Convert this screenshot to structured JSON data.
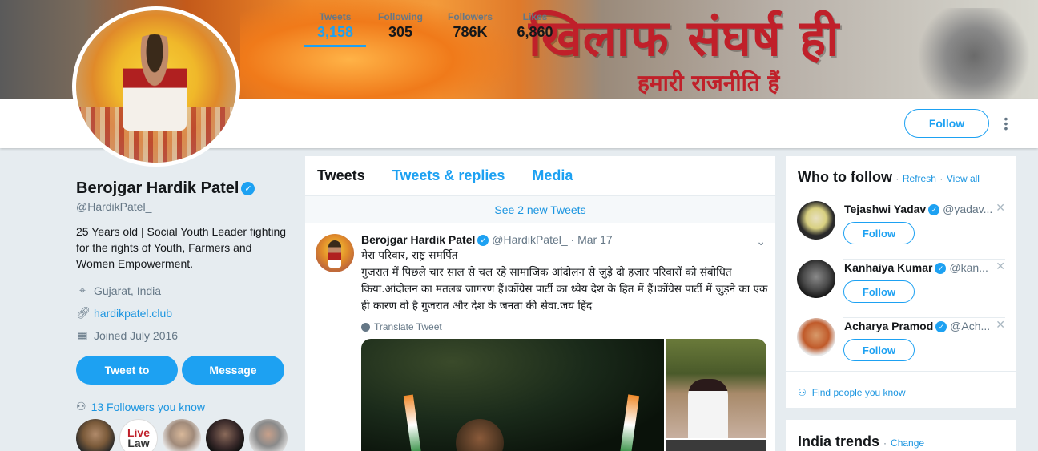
{
  "banner": {
    "headline": "खिलाफ संघर्ष ही",
    "subline": "हमारी राजनीति हैं"
  },
  "nav": {
    "stats": [
      {
        "label": "Tweets",
        "value": "3,158"
      },
      {
        "label": "Following",
        "value": "305"
      },
      {
        "label": "Followers",
        "value": "786K"
      },
      {
        "label": "Likes",
        "value": "6,860"
      }
    ],
    "follow_label": "Follow",
    "more_icon": "vertical-dots-icon"
  },
  "profile": {
    "name": "Berojgar Hardik Patel",
    "handle": "@HardikPatel_",
    "bio": "25 Years old | Social Youth Leader fighting for the rights of Youth, Farmers and Women Empowerment.",
    "location": "Gujarat, India",
    "website": "hardikpatel.club",
    "joined": "Joined July 2016",
    "tweet_to_label": "Tweet to",
    "message_label": "Message",
    "followers_you_know": "13 Followers you know",
    "mini_logo_line1": "Live",
    "mini_logo_line2": "Law"
  },
  "timeline": {
    "tabs": [
      "Tweets",
      "Tweets & replies",
      "Media"
    ],
    "new_tweets": "See 2 new Tweets",
    "tweet": {
      "author": "Berojgar Hardik Patel",
      "handle": "@HardikPatel_",
      "separator": "·",
      "date": "Mar 17",
      "text": "मेरा परिवार, राष्ट्र समर्पित\nगुजरात में पिछले चार साल से चल रहे सामाजिक आंदोलन से जुड़े दो हज़ार परिवारों को संबोधित किया.आंदोलन का मतलब जागरण हैं।कोंग्रेस पार्टी का ध्येय देश के हित में हैं।कोंग्रेस पार्टी में जुड़ने का एक ही कारण वो है गुजरात और देश के जनता की सेवा.जय हिंद",
      "translate": "Translate Tweet"
    }
  },
  "who_to_follow": {
    "title": "Who to follow",
    "dot": "·",
    "refresh": "Refresh",
    "view_all": "View all",
    "follow_label": "Follow",
    "suggestions": [
      {
        "name": "Tejashwi Yadav",
        "handle": "@yadav..."
      },
      {
        "name": "Kanhaiya Kumar",
        "handle": "@kan..."
      },
      {
        "name": "Acharya Pramod",
        "handle": "@Ach..."
      }
    ],
    "find_people": "Find people you know"
  },
  "trends": {
    "title": "India trends",
    "dot": "·",
    "change": "Change"
  },
  "colors": {
    "accent": "#1da1f2",
    "link": "#1b95e0",
    "muted": "#657786",
    "background": "#e6ecf0",
    "banner_text": "#c0202a"
  }
}
